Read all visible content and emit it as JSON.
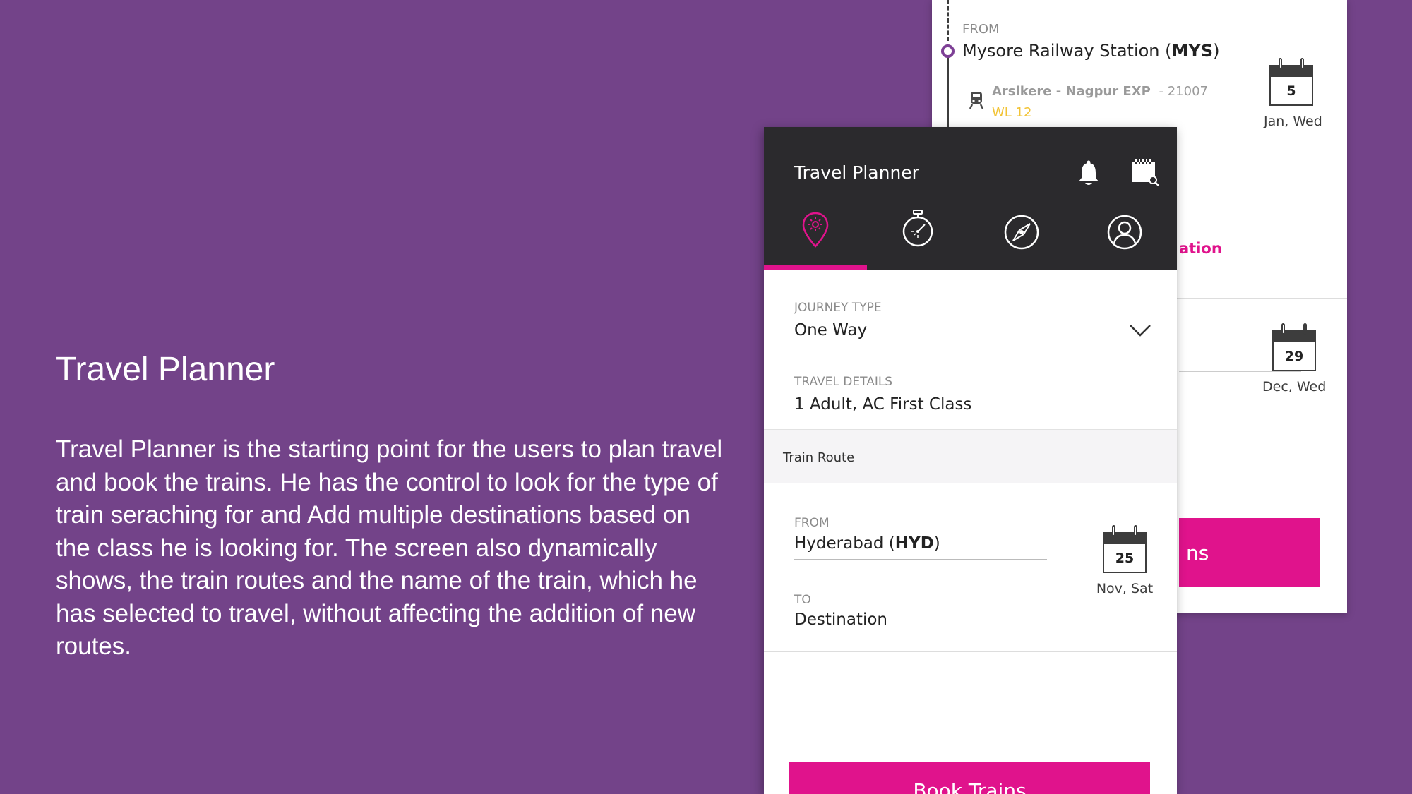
{
  "promo": {
    "title": "Travel Planner",
    "description": "Travel Planner is the starting point for the users to plan travel and book the trains. He has the control to look for the type of train seraching for and Add multiple destinations based on the class he is looking for.  The screen also dynamically shows, the train routes and the name of the train, which he has selected to travel, without affecting the addition of new routes."
  },
  "back_card": {
    "from_label": "FROM",
    "from_station_name": "Mysore Railway Station (",
    "from_station_code": "MYS",
    "from_station_close": ")",
    "train_name": "Arsikere - Nagpur EXP",
    "train_number": "- 21007",
    "waitlist": "WL 12",
    "date1_day": "5",
    "date1_label": "Jan, Wed",
    "add_destination_partial": "ation",
    "date2_day": "29",
    "date2_label": "Dec, Wed",
    "button_partial": "ns"
  },
  "app": {
    "title": "Travel Planner",
    "icons": {
      "bell": "bell-icon",
      "calendar_search": "calendar-search-icon"
    },
    "tabs": [
      {
        "name": "location-pin-icon",
        "active": true
      },
      {
        "name": "stopwatch-icon",
        "active": false
      },
      {
        "name": "compass-icon",
        "active": false
      },
      {
        "name": "profile-icon",
        "active": false
      }
    ],
    "journey_type_label": "JOURNEY TYPE",
    "journey_type_value": "One Way",
    "travel_details_label": "TRAVEL DETAILS",
    "travel_details_value": "1 Adult, AC First Class",
    "section_title": "Train Route",
    "from_label": "FROM",
    "from_city": "Hyderabad (",
    "from_code": "HYD",
    "from_close": ")",
    "to_label": "TO",
    "to_value": "Destination",
    "date_day": "25",
    "date_label": "Nov, Sat",
    "book_button": "Book Trains"
  },
  "colors": {
    "background": "#734389",
    "header": "#2b2a2d",
    "accent": "#e0138c",
    "waitlist": "#f2c335",
    "purple": "#7d3f95"
  }
}
